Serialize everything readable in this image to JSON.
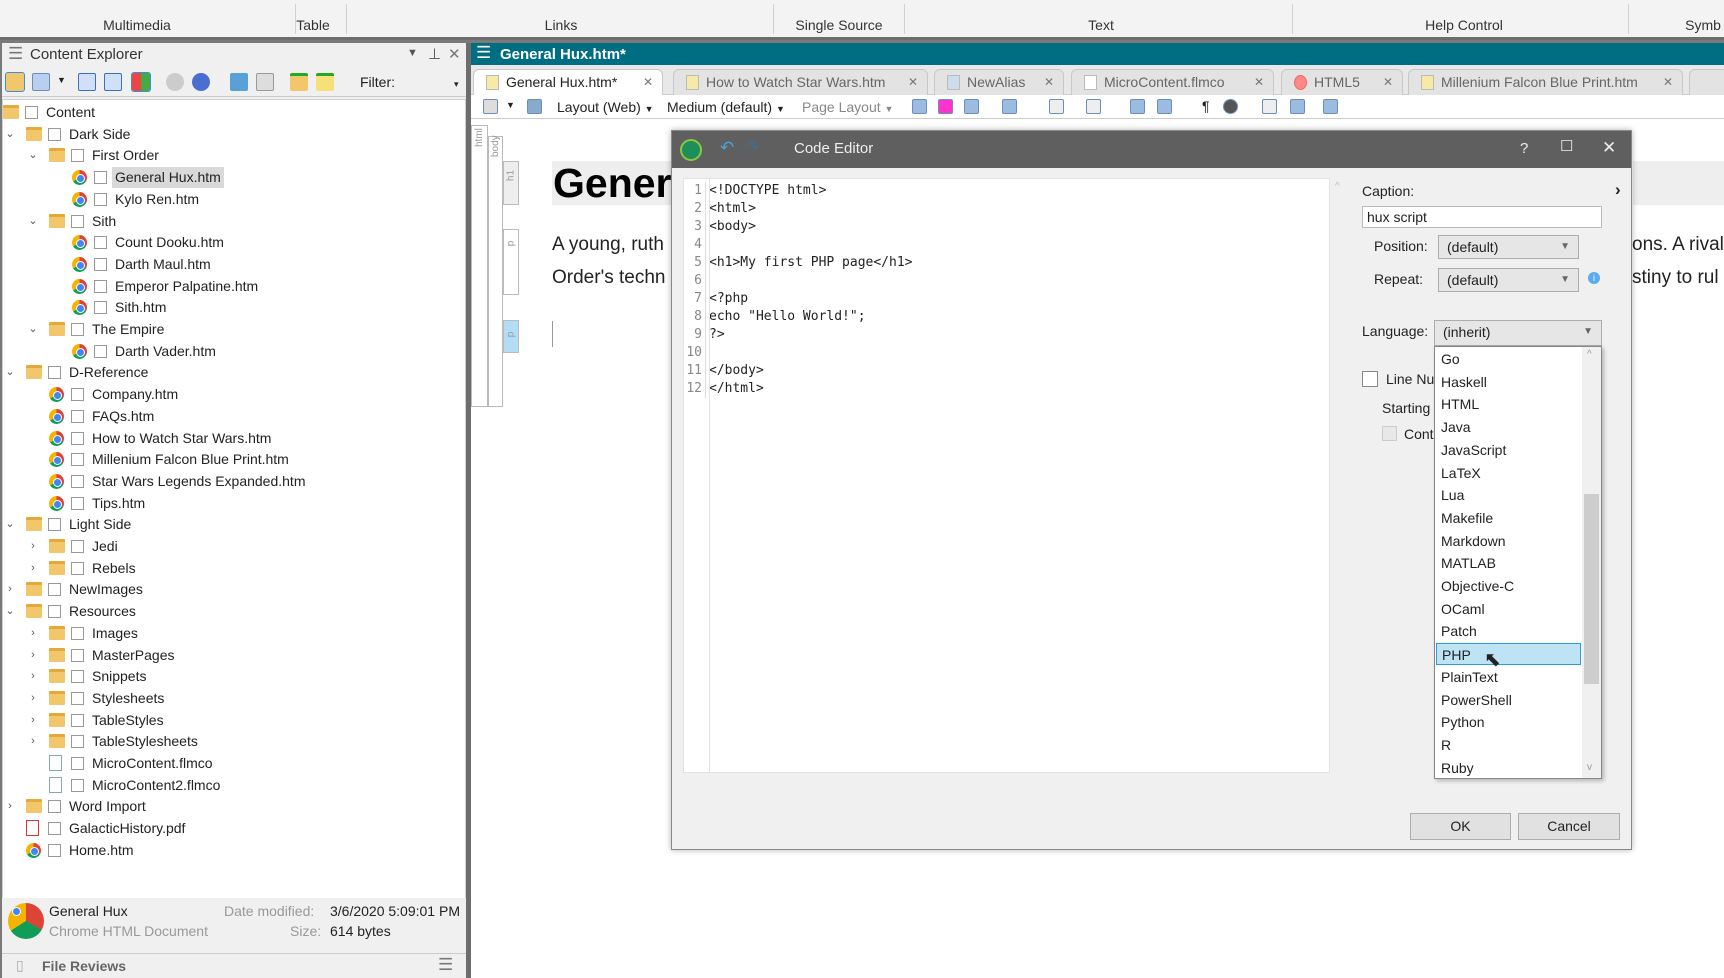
{
  "ribbon": {
    "groups": [
      "Multimedia",
      "Table",
      "Links",
      "Single Source",
      "Text",
      "Help Control",
      "Symb"
    ]
  },
  "explorer": {
    "title": "Content Explorer",
    "filter_label": "Filter:",
    "tree": [
      {
        "label": "Content",
        "depth": 0,
        "type": "folder"
      },
      {
        "label": "Dark Side",
        "depth": 1,
        "type": "folder",
        "state": "expanded"
      },
      {
        "label": "First Order",
        "depth": 2,
        "type": "folder",
        "state": "expanded"
      },
      {
        "label": "General Hux.htm",
        "depth": 3,
        "type": "chrome",
        "selected": true
      },
      {
        "label": "Kylo Ren.htm",
        "depth": 3,
        "type": "chrome"
      },
      {
        "label": "Sith",
        "depth": 2,
        "type": "folder",
        "state": "expanded"
      },
      {
        "label": "Count Dooku.htm",
        "depth": 3,
        "type": "chrome"
      },
      {
        "label": "Darth Maul.htm",
        "depth": 3,
        "type": "chrome"
      },
      {
        "label": "Emperor Palpatine.htm",
        "depth": 3,
        "type": "chrome"
      },
      {
        "label": "Sith.htm",
        "depth": 3,
        "type": "chrome"
      },
      {
        "label": "The Empire",
        "depth": 2,
        "type": "folder",
        "state": "expanded"
      },
      {
        "label": "Darth Vader.htm",
        "depth": 3,
        "type": "chrome"
      },
      {
        "label": "D-Reference",
        "depth": 1,
        "type": "folder",
        "state": "expanded"
      },
      {
        "label": "Company.htm",
        "depth": 2,
        "type": "chrome"
      },
      {
        "label": "FAQs.htm",
        "depth": 2,
        "type": "chrome"
      },
      {
        "label": "How to Watch Star Wars.htm",
        "depth": 2,
        "type": "chrome"
      },
      {
        "label": "Millenium Falcon Blue Print.htm",
        "depth": 2,
        "type": "chrome"
      },
      {
        "label": "Star Wars Legends Expanded.htm",
        "depth": 2,
        "type": "chrome"
      },
      {
        "label": "Tips.htm",
        "depth": 2,
        "type": "chrome"
      },
      {
        "label": "Light Side",
        "depth": 1,
        "type": "folder",
        "state": "expanded"
      },
      {
        "label": "Jedi",
        "depth": 2,
        "type": "folder",
        "state": "collapsed"
      },
      {
        "label": "Rebels",
        "depth": 2,
        "type": "folder",
        "state": "collapsed"
      },
      {
        "label": "NewImages",
        "depth": 1,
        "type": "folder",
        "state": "collapsed"
      },
      {
        "label": "Resources",
        "depth": 1,
        "type": "folder",
        "state": "expanded"
      },
      {
        "label": "Images",
        "depth": 2,
        "type": "folder",
        "state": "collapsed"
      },
      {
        "label": "MasterPages",
        "depth": 2,
        "type": "folder",
        "state": "collapsed"
      },
      {
        "label": "Snippets",
        "depth": 2,
        "type": "folder",
        "state": "collapsed"
      },
      {
        "label": "Stylesheets",
        "depth": 2,
        "type": "folder",
        "state": "collapsed"
      },
      {
        "label": "TableStyles",
        "depth": 2,
        "type": "folder",
        "state": "collapsed"
      },
      {
        "label": "TableStylesheets",
        "depth": 2,
        "type": "folder",
        "state": "collapsed"
      },
      {
        "label": "MicroContent.flmco",
        "depth": 2,
        "type": "file"
      },
      {
        "label": "MicroContent2.flmco",
        "depth": 2,
        "type": "file"
      },
      {
        "label": "Word Import",
        "depth": 1,
        "type": "folder",
        "state": "collapsed"
      },
      {
        "label": "GalacticHistory.pdf",
        "depth": 1,
        "type": "pdf"
      },
      {
        "label": "Home.htm",
        "depth": 1,
        "type": "chrome"
      }
    ],
    "status": {
      "name": "General Hux",
      "type": "Chrome HTML Document",
      "date_label": "Date modified:",
      "date": "3/6/2020 5:09:01 PM",
      "size_label": "Size:",
      "size": "614 bytes"
    },
    "file_reviews": "File Reviews"
  },
  "editor": {
    "title": "General Hux.htm*",
    "tabs": [
      "General Hux.htm*",
      "How to Watch Star Wars.htm",
      "NewAlias",
      "MicroContent.flmco",
      "HTML5",
      "Millenium Falcon Blue Print.htm"
    ],
    "toolbar": {
      "layout": "Layout (Web)",
      "medium": "Medium (default)",
      "page_layout": "Page Layout"
    },
    "element_bars": [
      "html",
      "body",
      "h1",
      "p",
      "p"
    ],
    "doc": {
      "heading": "Genera",
      "line1_left": "A young, ruth",
      "line2_left": "Order's techn",
      "line1_right": "ons. A rival",
      "line2_right": "stiny to rul"
    }
  },
  "code_editor": {
    "title": "Code Editor",
    "lines": [
      "<!DOCTYPE html>",
      "<html>",
      "<body>",
      "",
      "<h1>My first PHP page</h1>",
      "",
      "<?php",
      "echo \"Hello World!\";",
      "?>",
      "",
      "</body>",
      "</html>"
    ],
    "caption_label": "Caption:",
    "caption_value": "hux script",
    "position_label": "Position:",
    "position_value": "(default)",
    "repeat_label": "Repeat:",
    "repeat_value": "(default)",
    "language_label": "Language:",
    "language_value": "(inherit)",
    "line_numbers_label": "Line Nu",
    "starting_label": "Starting",
    "continue_label": "Cont",
    "language_options": [
      "Go",
      "Haskell",
      "HTML",
      "Java",
      "JavaScript",
      "LaTeX",
      "Lua",
      "Makefile",
      "Markdown",
      "MATLAB",
      "Objective-C",
      "OCaml",
      "Patch",
      "PHP",
      "PlainText",
      "PowerShell",
      "Python",
      "R",
      "Ruby"
    ],
    "highlighted_option": "PHP",
    "ok": "OK",
    "cancel": "Cancel",
    "help": "?"
  },
  "colors": {
    "title_bar": "#006e82",
    "dialog_title": "#5f5f5f",
    "highlight": "#bde3f5"
  }
}
